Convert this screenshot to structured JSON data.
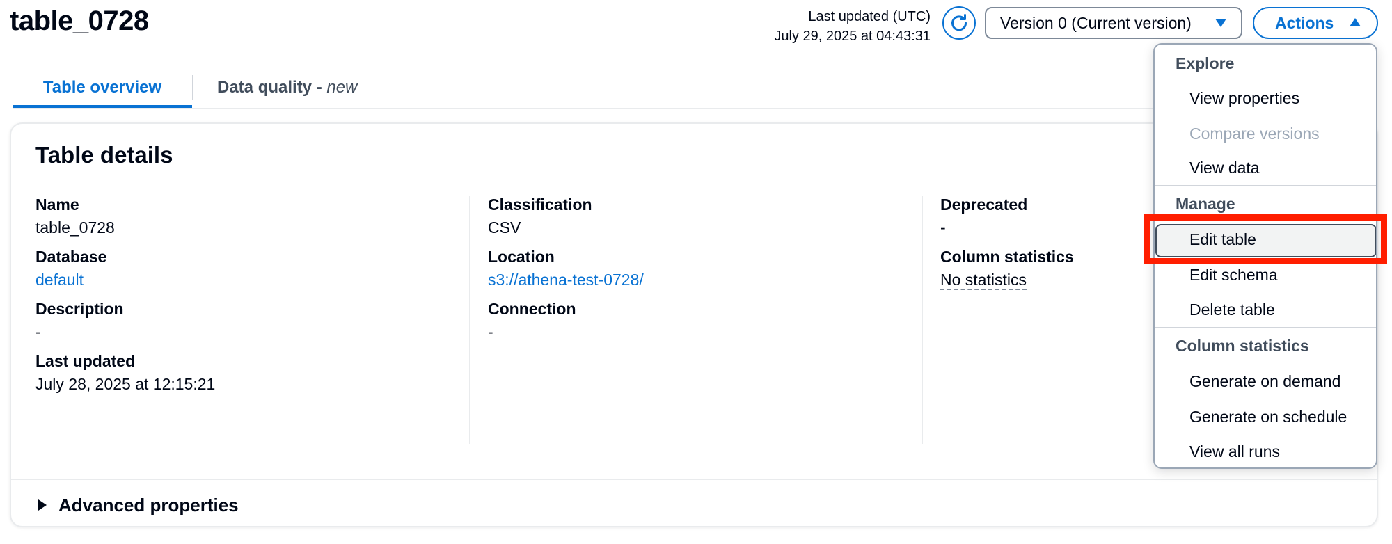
{
  "header": {
    "title": "table_0728",
    "last_updated_label": "Last updated (UTC)",
    "last_updated_value": "July 29, 2025 at 04:43:31",
    "refresh_icon": "refresh-icon",
    "version_select": "Version 0 (Current version)",
    "actions_label": "Actions"
  },
  "tabs": [
    {
      "label": "Table overview",
      "active": true
    },
    {
      "label": "Data quality - ",
      "suffix": "new",
      "active": false
    }
  ],
  "card": {
    "title": "Table details",
    "columns": [
      [
        {
          "label": "Name",
          "value": "table_0728"
        },
        {
          "label": "Database",
          "value": "default",
          "link": true
        },
        {
          "label": "Description",
          "value": "-"
        },
        {
          "label": "Last updated",
          "value": "July 28, 2025 at 12:15:21"
        }
      ],
      [
        {
          "label": "Classification",
          "value": "CSV"
        },
        {
          "label": "Location",
          "value": "s3://athena-test-0728/",
          "link": true
        },
        {
          "label": "Connection",
          "value": "-"
        }
      ],
      [
        {
          "label": "Deprecated",
          "value": "-"
        },
        {
          "label": "Column statistics",
          "value": "No statistics",
          "dotted": true
        }
      ]
    ],
    "advanced_label": "Advanced properties"
  },
  "actions_menu": {
    "groups": [
      {
        "title": "Explore",
        "items": [
          {
            "label": "View properties",
            "disabled": false
          },
          {
            "label": "Compare versions",
            "disabled": true
          },
          {
            "label": "View data",
            "disabled": false
          }
        ]
      },
      {
        "title": "Manage",
        "items": [
          {
            "label": "Edit table",
            "disabled": false,
            "highlighted": true
          },
          {
            "label": "Edit schema",
            "disabled": false
          },
          {
            "label": "Delete table",
            "disabled": false
          }
        ]
      },
      {
        "title": "Column statistics",
        "items": [
          {
            "label": "Generate on demand",
            "disabled": false
          },
          {
            "label": "Generate on schedule",
            "disabled": false
          },
          {
            "label": "View all runs",
            "disabled": false
          }
        ]
      }
    ]
  },
  "colors": {
    "accent": "#0972d3",
    "text": "#000716",
    "disabled": "#9ba7b6",
    "annotation_box": "#ff1e00"
  }
}
